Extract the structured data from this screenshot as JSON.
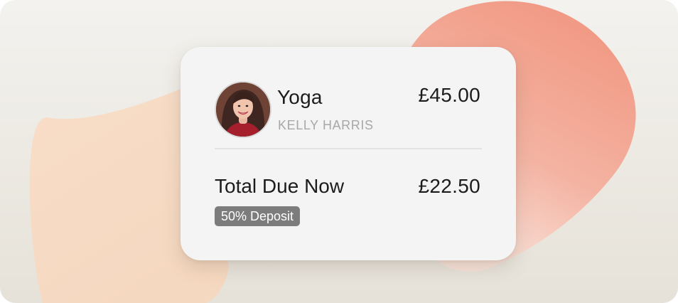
{
  "booking": {
    "service_name": "Yoga",
    "instructor": "KELLY HARRIS",
    "price": "£45.00"
  },
  "summary": {
    "total_label": "Total Due Now",
    "total_amount": "£22.50",
    "deposit_badge": "50% Deposit"
  },
  "colors": {
    "background": "#efede8",
    "card": "#f4f4f4",
    "blob_peach": "#f6dcc6",
    "blob_coral": "#f2a08d",
    "badge": "#7c7c7c",
    "secondary_text": "#a8a8a8",
    "primary_text": "#1c1c1c"
  },
  "icons": {
    "avatar": "instructor-portrait"
  }
}
